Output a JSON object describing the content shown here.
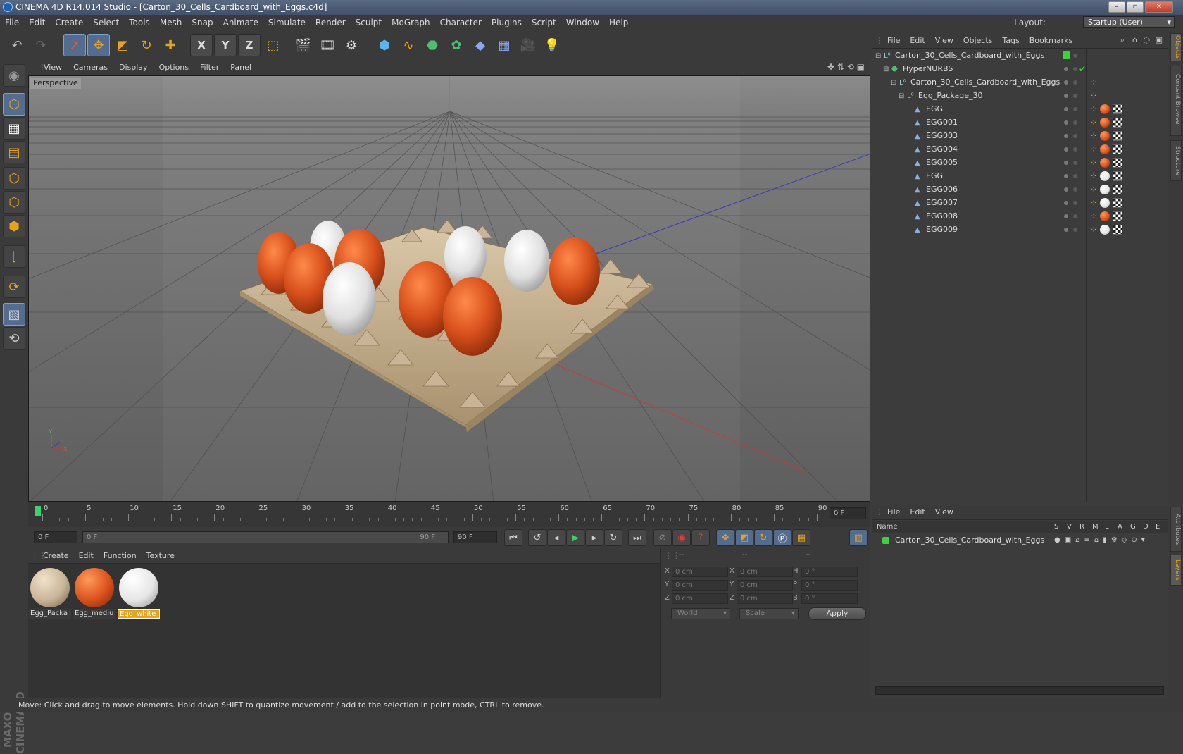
{
  "window": {
    "title": "CINEMA 4D R14.014 Studio - [Carton_30_Cells_Cardboard_with_Eggs.c4d]"
  },
  "menu": [
    "File",
    "Edit",
    "Create",
    "Select",
    "Tools",
    "Mesh",
    "Snap",
    "Animate",
    "Simulate",
    "Render",
    "Sculpt",
    "MoGraph",
    "Character",
    "Plugins",
    "Script",
    "Window",
    "Help"
  ],
  "layout": {
    "label": "Layout:",
    "value": "Startup (User)"
  },
  "toolbar": {
    "axis_x": "X",
    "axis_y": "Y",
    "axis_z": "Z"
  },
  "viewport": {
    "menu": [
      "View",
      "Cameras",
      "Display",
      "Options",
      "Filter",
      "Panel"
    ],
    "label": "Perspective",
    "axis": {
      "x": "X",
      "y": "Y",
      "z": "Z"
    }
  },
  "timeline": {
    "ticks": [
      "0",
      "5",
      "10",
      "15",
      "20",
      "25",
      "30",
      "35",
      "40",
      "45",
      "50",
      "55",
      "60",
      "65",
      "70",
      "75",
      "80",
      "85",
      "90"
    ],
    "frame_display": "0 F",
    "start_field": "0 F",
    "range_start": "0 F",
    "range_end": "90 F",
    "end_field": "90 F"
  },
  "materials": {
    "menu": [
      "Create",
      "Edit",
      "Function",
      "Texture"
    ],
    "items": [
      {
        "label": "Egg_Packa",
        "color": "#c9b497"
      },
      {
        "label": "Egg_mediu",
        "color": "#d8501c"
      },
      {
        "label": "Egg_white",
        "color": "#e6e6e6",
        "active": true
      }
    ]
  },
  "coords": {
    "head": [
      "--",
      "--",
      "--"
    ],
    "rows": [
      {
        "a": "X",
        "av": "0 cm",
        "b": "X",
        "bv": "0 cm",
        "c": "H",
        "cv": "0 °"
      },
      {
        "a": "Y",
        "av": "0 cm",
        "b": "Y",
        "bv": "0 cm",
        "c": "P",
        "cv": "0 °"
      },
      {
        "a": "Z",
        "av": "0 cm",
        "b": "Z",
        "bv": "0 cm",
        "c": "B",
        "cv": "0 °"
      }
    ],
    "mode": "World",
    "type": "Scale",
    "apply": "Apply"
  },
  "objects": {
    "menu": [
      "File",
      "Edit",
      "View",
      "Objects",
      "Tags",
      "Bookmarks"
    ],
    "tree": [
      {
        "name": "Carton_30_Cells_Cardboard_with_Eggs",
        "depth": 0,
        "kind": "null",
        "tag": "layer"
      },
      {
        "name": "HyperNURBS",
        "depth": 1,
        "kind": "nurbs",
        "tag": "check"
      },
      {
        "name": "Carton_30_Cells_Cardboard_with_Eggs",
        "depth": 2,
        "kind": "null",
        "tag": "dots"
      },
      {
        "name": "Egg_Package_30",
        "depth": 3,
        "kind": "null",
        "tag": "dots"
      },
      {
        "name": "EGG",
        "depth": 4,
        "kind": "poly",
        "tag": "orange"
      },
      {
        "name": "EGG001",
        "depth": 4,
        "kind": "poly",
        "tag": "orange"
      },
      {
        "name": "EGG003",
        "depth": 4,
        "kind": "poly",
        "tag": "orange"
      },
      {
        "name": "EGG004",
        "depth": 4,
        "kind": "poly",
        "tag": "orange"
      },
      {
        "name": "EGG005",
        "depth": 4,
        "kind": "poly",
        "tag": "orange"
      },
      {
        "name": "EGG",
        "depth": 4,
        "kind": "poly",
        "tag": "white"
      },
      {
        "name": "EGG006",
        "depth": 4,
        "kind": "poly",
        "tag": "white"
      },
      {
        "name": "EGG007",
        "depth": 4,
        "kind": "poly",
        "tag": "white"
      },
      {
        "name": "EGG008",
        "depth": 4,
        "kind": "poly",
        "tag": "orange"
      },
      {
        "name": "EGG009",
        "depth": 4,
        "kind": "poly",
        "tag": "white"
      }
    ]
  },
  "layers": {
    "menu": [
      "File",
      "Edit",
      "View"
    ],
    "header": {
      "name": "Name",
      "cols": [
        "S",
        "V",
        "R",
        "M",
        "L",
        "A",
        "G",
        "D",
        "E"
      ]
    },
    "rows": [
      {
        "name": "Carton_30_Cells_Cardboard_with_Eggs"
      }
    ]
  },
  "side_tabs": [
    "Objects",
    "Content Browser",
    "Structure",
    "Attributes",
    "Layers"
  ],
  "status": "Move: Click and drag to move elements. Hold down SHIFT to quantize movement / add to the selection in point mode, CTRL to remove.",
  "colors": {
    "accent": "#e8a317",
    "selection": "#536c8f",
    "egg_orange": "#d8501c",
    "egg_white": "#e6e6e6",
    "carton": "#c9b497"
  }
}
